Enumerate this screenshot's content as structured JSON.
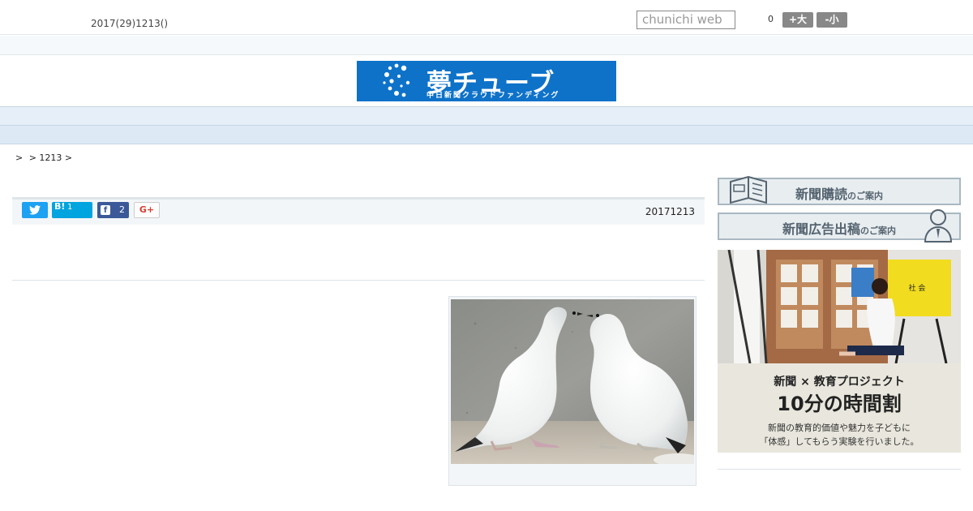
{
  "header": {
    "date": "2017(29)1213()",
    "search_placeholder": "chunichi web",
    "font_size_value": "0",
    "font_larger_label": "+大",
    "font_smaller_label": "-小"
  },
  "logo": {
    "main": "夢チューブ",
    "sub": "中日新聞クラウドファンディング",
    "bg_color": "#0e72c9"
  },
  "nav": {
    "items": [
      "　　",
      "　　",
      "　　",
      "　　",
      "　　",
      "　　",
      "　　",
      "　　",
      "　　"
    ]
  },
  "breadcrumb": {
    "items": [
      ">",
      "> 1213 >"
    ]
  },
  "share": {
    "hatena_label": "B!",
    "hatena_count": "1",
    "facebook_count": "2",
    "google_label": "G+",
    "article_date": "20171213"
  },
  "sidebar": {
    "subscription_main": "新聞購読",
    "subscription_suffix": "のご案内",
    "ad_main": "新聞広告出稿",
    "ad_suffix": "のご案内",
    "promo_line1": "新聞 × 教育プロジェクト",
    "promo_line2": "10分の時間割",
    "promo_line3": "新聞の教育的価値や魅力を子どもに",
    "promo_line4": "「体感」してもらう実験を行いました。",
    "promo_screen_label": "社 会"
  },
  "colors": {
    "twitter": "#1da1f2",
    "hatena": "#00a4de",
    "facebook": "#3b5998",
    "nav_bg": "#e6eff8"
  }
}
